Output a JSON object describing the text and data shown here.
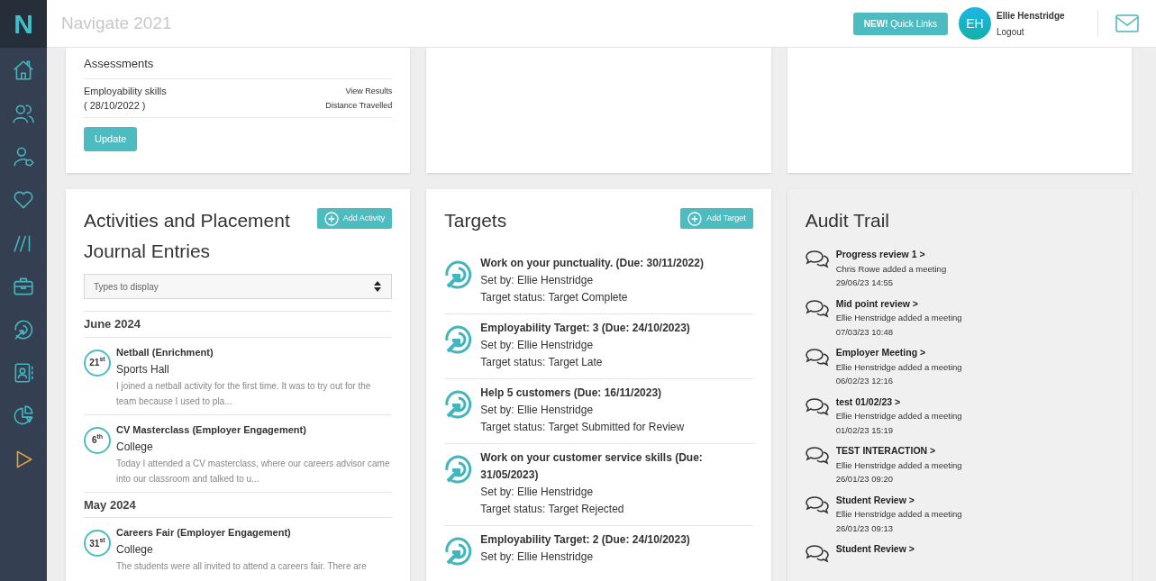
{
  "app": {
    "logo": "N",
    "title": "Navigate 2021"
  },
  "header": {
    "quick_links_badge": "NEW!",
    "quick_links": "Quick Links",
    "user": {
      "initials": "EH",
      "name": "Ellie Henstridge",
      "logout": "Logout"
    }
  },
  "sidebar": {
    "items": [
      {
        "kind": "home",
        "selected": false
      },
      {
        "kind": "people",
        "selected": false
      },
      {
        "kind": "person-tag",
        "selected": false
      },
      {
        "kind": "heart",
        "selected": false
      },
      {
        "kind": "slashes",
        "selected": false
      },
      {
        "kind": "briefcase",
        "selected": false
      },
      {
        "kind": "target",
        "selected": false
      },
      {
        "kind": "contact",
        "selected": false
      },
      {
        "kind": "pie",
        "selected": false
      },
      {
        "kind": "play",
        "selected": true
      }
    ]
  },
  "assessments": {
    "title": "Assessments",
    "rows": [
      {
        "name": "Employability skills",
        "date": "( 28/10/2022 )",
        "links": [
          "View Results",
          "Distance Travelled"
        ]
      }
    ],
    "update_button": "Update"
  },
  "activities": {
    "title": "Activities and Placement Journal Entries",
    "add_button": "Add Activity",
    "filter_placeholder": "Types to display",
    "groups": [
      {
        "month": "June 2024",
        "entries": [
          {
            "day": "21",
            "suffix": "st",
            "title": "Netball (Enrichment)",
            "location": "Sports Hall",
            "excerpt": "I joined a netball activity for the first time. It was to try out for the team because I used to pla..."
          },
          {
            "day": "6",
            "suffix": "th",
            "title": "CV Masterclass (Employer Engagement)",
            "location": "College",
            "excerpt": "Today I attended a CV masterclass, where our careers advisor came into our classroom and talked to u..."
          }
        ]
      },
      {
        "month": "May 2024",
        "entries": [
          {
            "day": "31",
            "suffix": "st",
            "title": "Careers Fair (Employer Engagement)",
            "location": "College",
            "excerpt": "The students were all invited to attend a careers fair. There are"
          }
        ]
      }
    ]
  },
  "targets": {
    "title": "Targets",
    "add_button": "Add Target",
    "items": [
      {
        "title": "Work on your punctuality. (Due: 30/11/2022)",
        "set_by": "Set by: Ellie Henstridge",
        "status": "Target status: Target Complete"
      },
      {
        "title": "Employability Target: 3 (Due: 24/10/2023)",
        "set_by": "Set by: Ellie Henstridge",
        "status": "Target status: Target Late"
      },
      {
        "title": "Help 5 customers (Due: 16/11/2023)",
        "set_by": "Set by: Ellie Henstridge",
        "status": "Target status: Target Submitted for Review"
      },
      {
        "title": "Work on your customer service skills (Due: 31/05/2023)",
        "set_by": "Set by: Ellie Henstridge",
        "status": "Target status: Target Rejected"
      },
      {
        "title": "Employability Target: 2 (Due: 24/10/2023)",
        "set_by": "Set by: Ellie Henstridge"
      }
    ]
  },
  "audit_trail": {
    "title": "Audit Trail",
    "items": [
      {
        "title": "Progress review 1",
        "caret": ">",
        "by": "Chris Rowe added a meeting",
        "time": "29/06/23 14:55"
      },
      {
        "title": "Mid point review",
        "caret": ">",
        "by": "Ellie Henstridge added a meeting",
        "time": "07/03/23 10:48"
      },
      {
        "title": "Employer Meeting",
        "caret": ">",
        "by": "Ellie Henstridge added a meeting",
        "time": "06/02/23 12:16"
      },
      {
        "title": "test 01/02/23",
        "caret": ">",
        "by": "Ellie Henstridge added a meeting",
        "time": "01/02/23 15:19"
      },
      {
        "title": "TEST INTERACTION",
        "caret": ">",
        "by": "Ellie Henstridge added a meeting",
        "time": "26/01/23 09:20"
      },
      {
        "title": "Student Review",
        "caret": ">",
        "by": "Ellie Henstridge added a meeting",
        "time": "26/01/23 09:13"
      },
      {
        "title": "Student Review",
        "caret": ">"
      }
    ]
  }
}
